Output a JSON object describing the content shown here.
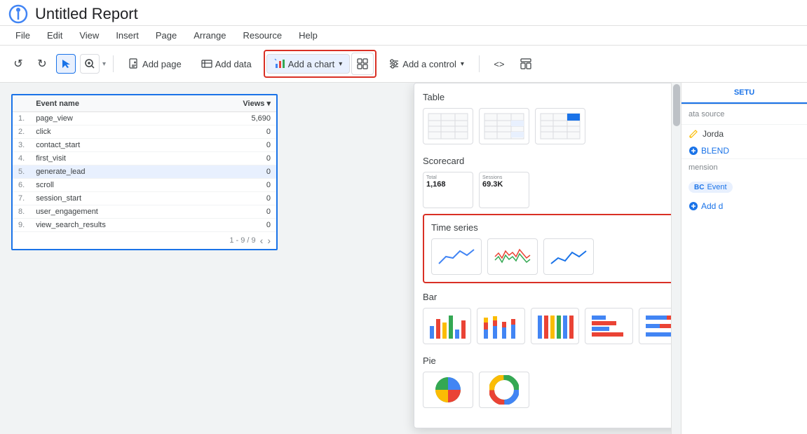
{
  "title": "Untitled Report",
  "logo": "looker-studio-logo",
  "menu": {
    "items": [
      "File",
      "Edit",
      "View",
      "Insert",
      "Page",
      "Arrange",
      "Resource",
      "Help"
    ]
  },
  "toolbar": {
    "undo_label": "↺",
    "redo_label": "↻",
    "select_label": "↖",
    "zoom_label": "⊕",
    "add_page_label": "Add page",
    "add_data_label": "Add data",
    "add_chart_label": "Add a chart",
    "add_control_label": "Add a control",
    "code_label": "<>"
  },
  "table": {
    "headers": [
      "Event name",
      "Views ▾"
    ],
    "rows": [
      {
        "num": "1.",
        "name": "page_view",
        "value": "5,690",
        "selected": false
      },
      {
        "num": "2.",
        "name": "click",
        "value": "0",
        "selected": false
      },
      {
        "num": "3.",
        "name": "contact_start",
        "value": "0",
        "selected": false
      },
      {
        "num": "4.",
        "name": "first_visit",
        "value": "0",
        "selected": false
      },
      {
        "num": "5.",
        "name": "generate_lead",
        "value": "0",
        "selected": true
      },
      {
        "num": "6.",
        "name": "scroll",
        "value": "0",
        "selected": false
      },
      {
        "num": "7.",
        "name": "session_start",
        "value": "0",
        "selected": false
      },
      {
        "num": "8.",
        "name": "user_engagement",
        "value": "0",
        "selected": false
      },
      {
        "num": "9.",
        "name": "view_search_results",
        "value": "0",
        "selected": false
      }
    ],
    "pagination": "1 - 9 / 9"
  },
  "chart_picker": {
    "table_label": "Table",
    "scorecard_label": "Scorecard",
    "scorecard_total": "1,168",
    "scorecard_sessions": "69.3K",
    "time_series_label": "Time series",
    "bar_label": "Bar",
    "pie_label": "Pie"
  },
  "right_panel": {
    "tab_label": "SETU",
    "data_source_label": "ata source",
    "data_source_name": "Jorda",
    "blend_label": "BLEND",
    "dimension_label": "mension",
    "dimension_chip": "Event",
    "add_dim_label": "Add d"
  }
}
